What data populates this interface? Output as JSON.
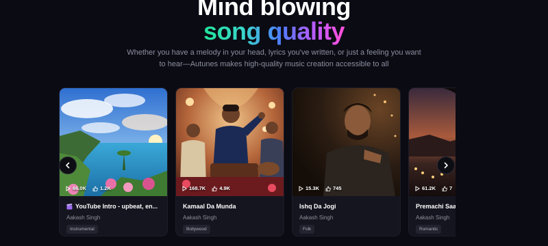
{
  "hero": {
    "title_line1": "Mind blowing",
    "title_line2": "song quality",
    "subtitle": "Whether you have a melody in your head, lyrics you've written, or just a feeling you want to hear—Autunes makes high-quality music creation accessible to all"
  },
  "carousel": {
    "prev_icon": "chevron-left-icon",
    "next_icon": "chevron-right-icon",
    "cards": [
      {
        "title": "YouTube Intro - upbeat, en...",
        "title_icon": "clapperboard-icon",
        "artist": "Aakash Singh",
        "genre": "Instrumental",
        "plays": "66.0K",
        "likes": "1.2K",
        "image": "coastal sunset landscape"
      },
      {
        "title": "Kamaal Da Munda",
        "title_icon": "",
        "artist": "Aakash Singh",
        "genre": "Bollywood",
        "plays": "168.7K",
        "likes": "4.9K",
        "image": "singer with musicians in palace"
      },
      {
        "title": "Ishq Da Jogi",
        "title_icon": "",
        "artist": "Aakash Singh",
        "genre": "Folk",
        "plays": "15.3K",
        "likes": "745",
        "image": "man portrait dark background"
      },
      {
        "title": "Premachi Saa",
        "title_icon": "",
        "artist": "Aakash Singh",
        "genre": "Romantic",
        "plays": "61.2K",
        "likes": "7",
        "image": "woman silhouette at dusk"
      }
    ]
  },
  "colors": {
    "background": "#0b0b14",
    "card": "#15151f",
    "gradient_start": "#22e39a",
    "gradient_end": "#ff4fd8"
  }
}
